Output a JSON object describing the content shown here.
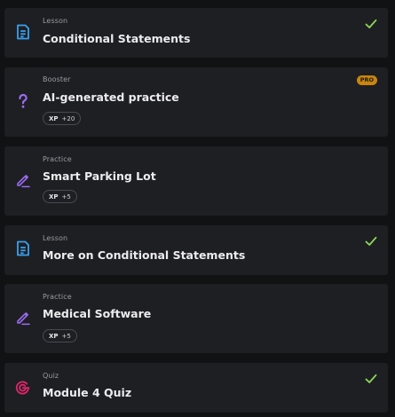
{
  "colors": {
    "lesson_icon": "#3aa0ee",
    "practice_icon": "#9b6cf2",
    "booster_icon": "#9b6cf2",
    "quiz_icon": "#e0266a",
    "check": "#8fd858",
    "pro_badge": "#c9850e"
  },
  "items": [
    {
      "type_label": "Lesson",
      "title": "Conditional Statements",
      "icon": "document-icon",
      "completed": true
    },
    {
      "type_label": "Booster",
      "title": "AI-generated practice",
      "icon": "question-mark-icon",
      "badge": "PRO",
      "xp_label": "XP",
      "xp_value": "+20"
    },
    {
      "type_label": "Practice",
      "title": "Smart Parking Lot",
      "icon": "pencil-icon",
      "xp_label": "XP",
      "xp_value": "+5"
    },
    {
      "type_label": "Lesson",
      "title": "More on Conditional Statements",
      "icon": "document-icon",
      "completed": true
    },
    {
      "type_label": "Practice",
      "title": "Medical Software",
      "icon": "pencil-icon",
      "xp_label": "XP",
      "xp_value": "+5"
    },
    {
      "type_label": "Quiz",
      "title": "Module 4 Quiz",
      "icon": "target-icon",
      "completed": true
    }
  ]
}
